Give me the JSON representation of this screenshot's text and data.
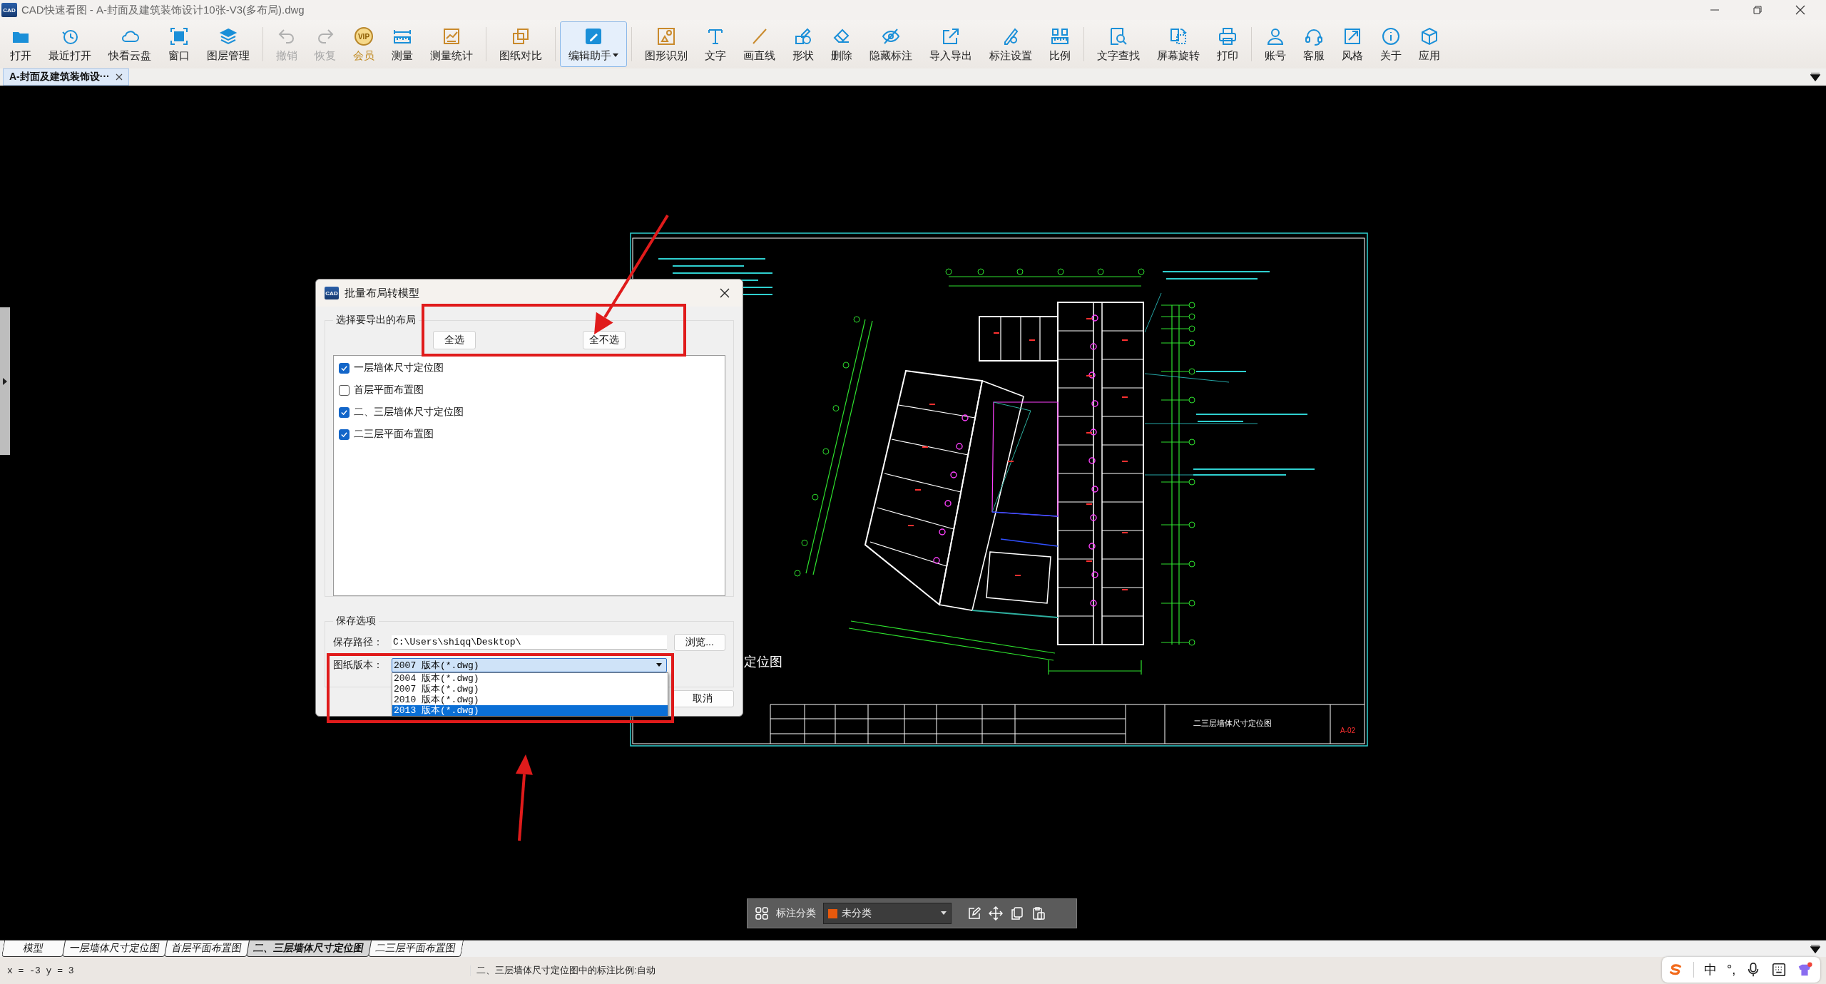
{
  "window": {
    "logo_text": "CAD",
    "title": "CAD快速看图 - A-封面及建筑装饰设计10张-V3(多布局).dwg"
  },
  "toolbar": {
    "groups": [
      [
        {
          "label": "打开",
          "kind": "button",
          "disabled": false,
          "selected": false
        },
        {
          "label": "最近打开",
          "kind": "button",
          "disabled": false,
          "selected": false
        },
        {
          "label": "快看云盘",
          "kind": "button",
          "disabled": false,
          "selected": false
        },
        {
          "label": "窗口",
          "kind": "button",
          "disabled": false,
          "selected": false
        },
        {
          "label": "图层管理",
          "kind": "button",
          "disabled": false,
          "selected": false
        }
      ],
      [
        {
          "label": "撤销",
          "kind": "button",
          "disabled": true,
          "selected": false
        },
        {
          "label": "恢复",
          "kind": "button",
          "disabled": true,
          "selected": false
        },
        {
          "label": "会员",
          "kind": "vip",
          "badge": "VIP",
          "disabled": false,
          "selected": false
        },
        {
          "label": "测量",
          "kind": "button",
          "disabled": false,
          "selected": false
        },
        {
          "label": "测量统计",
          "kind": "button",
          "disabled": false,
          "selected": false
        }
      ],
      [
        {
          "label": "图纸对比",
          "kind": "button",
          "disabled": false,
          "selected": false
        }
      ],
      [
        {
          "label": "编辑助手",
          "kind": "menu",
          "disabled": false,
          "selected": true
        }
      ],
      [
        {
          "label": "图形识别",
          "kind": "button",
          "disabled": false,
          "selected": false
        },
        {
          "label": "文字",
          "kind": "button",
          "disabled": false,
          "selected": false
        },
        {
          "label": "画直线",
          "kind": "button",
          "disabled": false,
          "selected": false
        },
        {
          "label": "形状",
          "kind": "button",
          "disabled": false,
          "selected": false
        },
        {
          "label": "删除",
          "kind": "button",
          "disabled": false,
          "selected": false
        },
        {
          "label": "隐藏标注",
          "kind": "button",
          "disabled": false,
          "selected": false
        },
        {
          "label": "导入导出",
          "kind": "button",
          "disabled": false,
          "selected": false
        },
        {
          "label": "标注设置",
          "kind": "button",
          "disabled": false,
          "selected": false
        },
        {
          "label": "比例",
          "kind": "button",
          "disabled": false,
          "selected": false
        }
      ],
      [
        {
          "label": "文字查找",
          "kind": "button",
          "disabled": false,
          "selected": false
        },
        {
          "label": "屏幕旋转",
          "kind": "button",
          "disabled": false,
          "selected": false
        },
        {
          "label": "打印",
          "kind": "button",
          "disabled": false,
          "selected": false
        }
      ],
      [
        {
          "label": "账号",
          "kind": "button",
          "disabled": false,
          "selected": false
        },
        {
          "label": "客服",
          "kind": "button",
          "disabled": false,
          "selected": false
        },
        {
          "label": "风格",
          "kind": "button",
          "disabled": false,
          "selected": false
        },
        {
          "label": "关于",
          "kind": "button",
          "disabled": false,
          "selected": false
        },
        {
          "label": "应用",
          "kind": "button",
          "disabled": false,
          "selected": false
        }
      ]
    ]
  },
  "document_tabs": [
    {
      "label": "A-封面及建筑装饰设···",
      "selected": true
    }
  ],
  "drawing": {
    "caption": "定位图",
    "title_block": {
      "drawing_name": "二三层墙体尺寸定位图",
      "sheet_number": "A-02"
    }
  },
  "dialog": {
    "logo_text": "CAD",
    "title": "批量布局转模型",
    "layout_group": {
      "legend": "选择要导出的布局",
      "buttons": [
        "全选",
        "全不选"
      ],
      "items": [
        {
          "label": "一层墙体尺寸定位图",
          "checked": true
        },
        {
          "label": "首层平面布置图",
          "checked": false
        },
        {
          "label": "二、三层墙体尺寸定位图",
          "checked": true
        },
        {
          "label": "二三层平面布置图",
          "checked": true
        }
      ]
    },
    "save_group": {
      "legend": "保存选项",
      "path_label": "保存路径：",
      "path": "C:\\Users\\shiqq\\Desktop\\",
      "browse": "浏览...",
      "version_label": "图纸版本：",
      "version": "2007 版本(*.dwg)",
      "version_options": [
        {
          "label": "2004 版本(*.dwg)",
          "selected": false
        },
        {
          "label": "2007 版本(*.dwg)",
          "selected": false
        },
        {
          "label": "2010 版本(*.dwg)",
          "selected": false
        },
        {
          "label": "2013 版本(*.dwg)",
          "selected": true
        }
      ]
    },
    "cancel": "取消"
  },
  "annotation_bar": {
    "label": "标注分类",
    "category": {
      "label": "未分类",
      "color": "#e8590c"
    }
  },
  "layout_tabs": [
    {
      "label": "模型",
      "selected": false
    },
    {
      "label": "一层墙体尺寸定位图",
      "selected": false
    },
    {
      "label": "首层平面布置图",
      "selected": false
    },
    {
      "label": "二、三层墙体尺寸定位图",
      "selected": true
    },
    {
      "label": "二三层平面布置图",
      "selected": false
    }
  ],
  "status_bar": {
    "coordinates": "x = -3 y = 3",
    "message": "二、三层墙体尺寸定位图中的标注比例:自动"
  },
  "ime_bar": {
    "mode": "中",
    "punctuation": "°,"
  }
}
